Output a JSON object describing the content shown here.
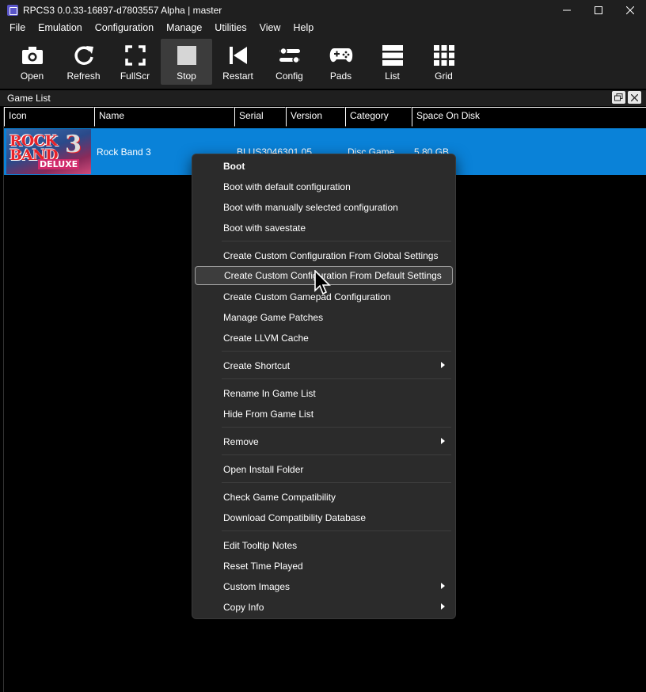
{
  "window": {
    "title": "RPCS3 0.0.33-16897-d7803557 Alpha | master",
    "controls": [
      "minimize",
      "maximize",
      "close"
    ]
  },
  "menubar": [
    "File",
    "Emulation",
    "Configuration",
    "Manage",
    "Utilities",
    "View",
    "Help"
  ],
  "toolbar": [
    {
      "label": "Open",
      "icon": "camera-icon"
    },
    {
      "label": "Refresh",
      "icon": "refresh-icon"
    },
    {
      "label": "FullScr",
      "icon": "fullscreen-icon"
    },
    {
      "label": "Stop",
      "icon": "stop-icon",
      "active": true
    },
    {
      "label": "Restart",
      "icon": "restart-icon"
    },
    {
      "label": "Config",
      "icon": "config-icon"
    },
    {
      "label": "Pads",
      "icon": "gamepad-icon"
    },
    {
      "label": "List",
      "icon": "list-icon"
    },
    {
      "label": "Grid",
      "icon": "grid-icon"
    }
  ],
  "game_list": {
    "title": "Game List",
    "columns": [
      "Icon",
      "Name",
      "Serial",
      "Version",
      "Category",
      "Space On Disk"
    ],
    "rows": [
      {
        "name": "Rock Band 3",
        "serial": "BLUS30463",
        "version": "01.05",
        "category": "Disc Game",
        "space": "5.80 GB",
        "cover_text": [
          "ROCK",
          "BAND",
          "3",
          "DELUXE"
        ]
      }
    ]
  },
  "context_menu": {
    "items": [
      {
        "label": "Boot",
        "bold": true
      },
      {
        "label": "Boot with default configuration"
      },
      {
        "label": "Boot with manually selected configuration"
      },
      {
        "label": "Boot with savestate"
      },
      {
        "label": "Create Custom Configuration From Global Settings"
      },
      {
        "label": "Create Custom Configuration From Default Settings",
        "highlighted": true
      },
      {
        "label": "Create Custom Gamepad Configuration"
      },
      {
        "label": "Manage Game Patches"
      },
      {
        "label": "Create LLVM Cache"
      },
      {
        "label": "Create Shortcut",
        "submenu": true
      },
      {
        "label": "Rename In Game List"
      },
      {
        "label": "Hide From Game List"
      },
      {
        "label": "Remove",
        "submenu": true
      },
      {
        "label": "Open Install Folder"
      },
      {
        "label": "Check Game Compatibility"
      },
      {
        "label": "Download Compatibility Database"
      },
      {
        "label": "Edit Tooltip Notes"
      },
      {
        "label": "Reset Time Played"
      },
      {
        "label": "Custom Images",
        "submenu": true
      },
      {
        "label": "Copy Info",
        "submenu": true
      }
    ]
  }
}
